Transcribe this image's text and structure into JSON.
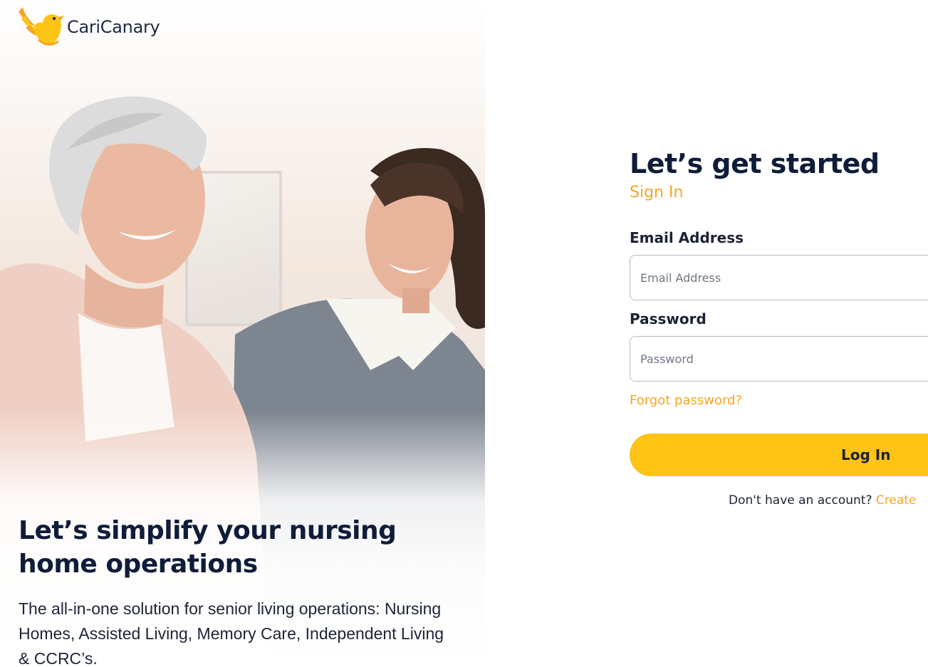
{
  "brand": {
    "name": "CariCanary",
    "logo_icon": "canary-bird-icon",
    "accent": "#fdc315",
    "accent_text": "#f5a623",
    "navy": "#0f1d3a"
  },
  "hero": {
    "image": "caregiver-with-senior-photo",
    "title": "Let’s simplify your nursing home operations",
    "description": "The all-in-one solution for senior living operations: Nursing Homes, Assisted Living, Memory Care, Independent Living & CCRC’s."
  },
  "form": {
    "heading": "Let’s get started",
    "subheading": "Sign In",
    "email": {
      "label": "Email Address",
      "placeholder": "Email Address",
      "value": ""
    },
    "password": {
      "label": "Password",
      "placeholder": "Password",
      "value": ""
    },
    "forgot_link": "Forgot password?",
    "submit_label": "Log In",
    "signup_prompt": "Don't have an account?",
    "signup_link": "Create"
  }
}
